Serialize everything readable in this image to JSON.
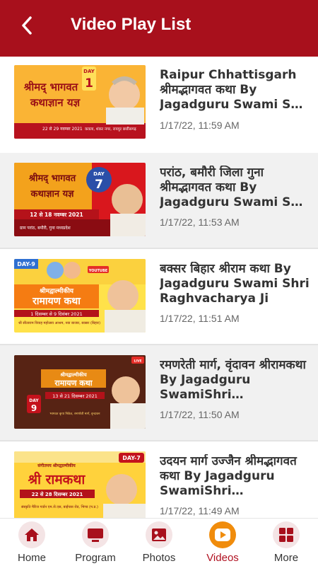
{
  "header": {
    "title": "Video Play List",
    "back_icon": "chevron-left-icon",
    "bg_color": "#a8101c"
  },
  "videos": [
    {
      "title": "Raipur Chhattisgarh श्रीमद्भागवत कथा By Jagadguru Swami Shri Raghvacharya Ji",
      "date": "1/17/22, 11:59 AM",
      "thumb": {
        "day_badge": "DAY",
        "day_number": "1",
        "heading_line1": "श्रीमद् भागवत",
        "heading_line2": "कथाज्ञान यज्ञ",
        "dates": "22 से 29 नवम्बर 2021",
        "venue": "कवला, शंकर नगर, रायपुर छत्तीसगढ़"
      }
    },
    {
      "title": "परांठ, बमौरी जिला गुना श्रीमद्भागवत कथा By Jagadguru Swami Shri Raghvacharya Ji",
      "date": "1/17/22, 11:53 AM",
      "thumb": {
        "day_badge": "DAY",
        "day_number": "7",
        "heading_line1": "श्रीमद् भागवत",
        "heading_line2": "कथाज्ञान यज्ञ",
        "dates": "12 से 18 नवम्बर 2021",
        "venue": "ग्राम परांठ, बमौरी, गुना मध्यप्रदेश"
      }
    },
    {
      "title": "बक्सर बिहार श्रीराम कथा By Jagadguru Swami Shri Raghvacharya Ji",
      "date": "1/17/22, 11:51 AM",
      "thumb": {
        "day_badge": "DAY-9",
        "day_number": "",
        "heading_line1": "श्रीमद्वाल्मीकीय",
        "heading_line2": "रामायण कथा",
        "dates": "1 दिसम्बर से 9 दिसंबर 2021",
        "venue": "श्री सीताराम विवाह महोत्सव आश्रम, नया बाजार, बक्सर (बिहार)",
        "stream_label": "YOUTUBE"
      }
    },
    {
      "title": "रमणरेती मार्ग, वृंदावन श्रीरामकथा By Jagadguru SwamiShri Raghvacharya Ji",
      "date": "1/17/22, 11:50 AM",
      "thumb": {
        "day_badge": "DAY",
        "day_number": "9",
        "heading_line1": "श्रीमद्वाल्मीकीय",
        "heading_line2": "रामायण कथा",
        "dates": "13 से 21 दिसम्बर 2021",
        "venue": "भागवत कृपा निकेत, रमणरेती मार्ग, वृन्दावन",
        "stream_label": "LIVE"
      }
    },
    {
      "title": "उदयन मार्ग उज्जैन श्रीमद्भागवत कथा By Jagadguru SwamiShri Raghvacharya Ji",
      "date": "1/17/22, 11:49 AM",
      "thumb": {
        "day_badge": "DAY-7",
        "day_number": "",
        "heading_line1": "संगीतमय श्रीमद्वाल्मीकीय",
        "heading_line2": "श्री रामकथा",
        "dates": "22 से 28 दिसम्बर 2021",
        "venue": "संस्कृति मैरिज गार्डन एम.जे.एस, बाईपास रोड, भिण्ड (म.प्र.)"
      }
    }
  ],
  "bottom_nav": [
    {
      "label": "Home",
      "icon": "home-icon",
      "active": false
    },
    {
      "label": "Program",
      "icon": "tv-icon",
      "active": false
    },
    {
      "label": "Photos",
      "icon": "image-icon",
      "active": false
    },
    {
      "label": "Videos",
      "icon": "play-icon",
      "active": true
    },
    {
      "label": "More",
      "icon": "grid-icon",
      "active": false
    }
  ],
  "colors": {
    "accent": "#a8101c",
    "active_nav_icon": "#f08c0c",
    "active_nav_label": "#b01020",
    "inactive_nav_icon_bg": "#f4e4e5"
  }
}
